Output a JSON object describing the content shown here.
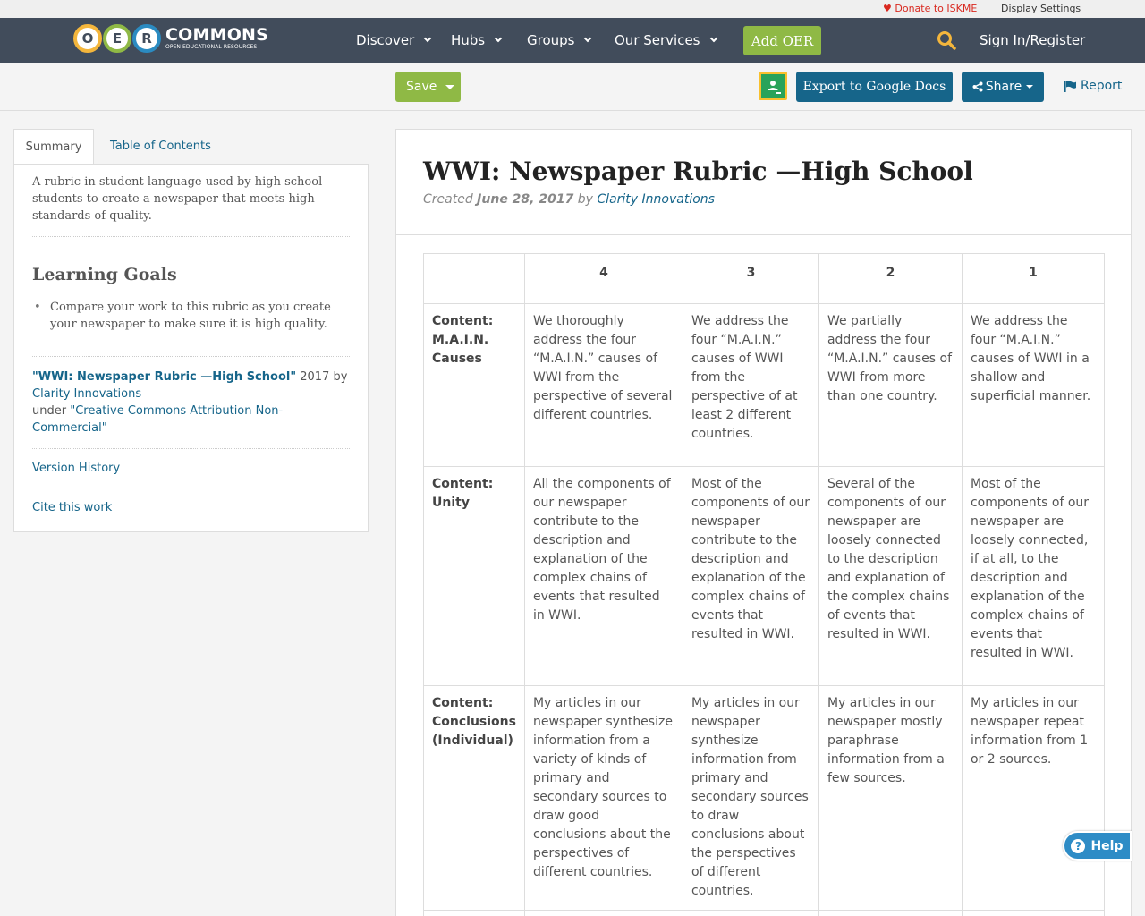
{
  "utility": {
    "donate": "Donate to ISKME",
    "display_settings": "Display Settings"
  },
  "nav": {
    "logo_letters": [
      "O",
      "E",
      "R"
    ],
    "logo_word": "COMMONS",
    "logo_tagline": "OPEN EDUCATIONAL RESOURCES",
    "items": [
      "Discover",
      "Hubs",
      "Groups",
      "Our Services"
    ],
    "add_oer": "Add OER",
    "signin": "Sign In/Register"
  },
  "actions": {
    "save": "Save",
    "export": "Export to Google Docs",
    "share": "Share",
    "report": "Report"
  },
  "sidebar": {
    "tabs": [
      "Summary",
      "Table of Contents"
    ],
    "summary": "A rubric in student language used by high school students to create a newspaper that meets high standards of quality.",
    "learning_goals_title": "Learning Goals",
    "learning_goals": [
      "Compare your work to this rubric as you create your newspaper to make sure it is high quality."
    ],
    "attribution": {
      "title": "\"WWI: Newspaper Rubric —High School\"",
      "year_by": " 2017 by ",
      "author": "Clarity Innovations",
      "under": "under ",
      "license": "\"Creative Commons Attribution Non-Commercial\""
    },
    "version_history": "Version History",
    "cite": "Cite this work"
  },
  "main": {
    "title": "WWI: Newspaper Rubric —High School",
    "created_label": "Created ",
    "created_date": "June 28, 2017",
    "by_label": " by ",
    "author": "Clarity Innovations"
  },
  "rubric": {
    "headers": [
      "",
      "4",
      "3",
      "2",
      "1"
    ],
    "rows": [
      {
        "criterion": "Content: M.A.I.N. Causes",
        "cells": [
          "We thoroughly address the four “M.A.I.N.” causes of WWI from the perspective of several different countries.",
          "We address the four “M.A.I.N.” causes of WWI from the perspective of at least 2 different countries.",
          "We partially address the four “M.A.I.N.” causes of WWI from more than one country.",
          "We address the four “M.A.I.N.” causes of WWI in a shallow and superficial manner."
        ]
      },
      {
        "criterion": "Content: Unity",
        "cells": [
          "All the components of our newspaper contribute to the description and explanation of the complex chains of events that resulted in WWI.",
          "Most of the components of our newspaper contribute to the description and explanation of the complex chains of events that resulted in WWI.",
          "Several of the components of our newspaper are loosely connected to the description and explanation of the complex chains of events that resulted in WWI.",
          "Most of the components of our newspaper are loosely connected, if at all, to the description and explanation of the complex chains of events that resulted in WWI."
        ]
      },
      {
        "criterion": "Content: Conclusions (Individual)",
        "cells": [
          "My articles in our newspaper synthesize information from a variety of kinds of primary and secondary sources to draw good conclusions about the perspectives of different countries.",
          "My articles in our newspaper synthesize information from primary and secondary sources to draw conclusions about the perspectives of different countries.",
          "My articles in our newspaper mostly paraphrase information from a few sources.",
          "My articles in our newspaper repeat information from 1 or 2 sources."
        ]
      }
    ]
  },
  "help": {
    "label": "Help",
    "glyph": "?"
  },
  "colors": {
    "nav_bg": "#414c5b",
    "green": "#8fb945",
    "blue": "#16658a",
    "donate_red": "#d9281f",
    "search_yellow": "#f4b63c"
  }
}
